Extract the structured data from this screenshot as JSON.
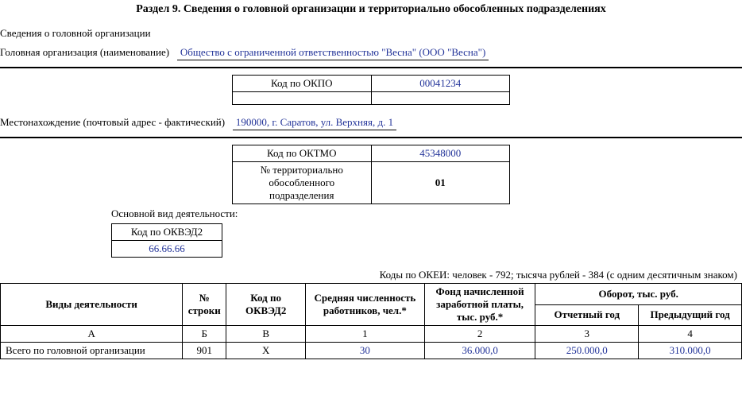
{
  "section_title": "Раздел 9. Сведения о головной организации и территориально обособленных подразделениях",
  "head_org_info_label": "Сведения о головной организации",
  "head_org_name_label": "Головная организация (наименование)",
  "head_org_name_value": "Общество с ограниченной ответственностью \"Весна\" (ООО \"Весна\")",
  "okpo": {
    "label": "Код по ОКПО",
    "value": "00041234"
  },
  "location_label": "Местонахождение (почтовый адрес - фактический)",
  "location_value": "190000, г. Саратов, ул. Верхняя, д. 1",
  "oktmo": {
    "label": "Код по ОКТМО",
    "value": "45348000"
  },
  "unit": {
    "label": "№ территориально обособленного подразделения",
    "value": "01"
  },
  "activity_label": "Основной вид деятельности:",
  "okved": {
    "label": "Код по ОКВЭД2",
    "value": "66.66.66"
  },
  "okei_note": "Коды по ОКЕИ: человек - 792; тысяча рублей - 384 (с одним десятичным знаком)",
  "table": {
    "headers": {
      "a": "Виды деятельности",
      "b": "№ строки",
      "v": "Код по ОКВЭД2",
      "c1": "Средняя численность работников, чел.*",
      "c2": "Фонд начисленной заработной платы, тыс. руб.*",
      "turnover": "Оборот, тыс. руб.",
      "c3": "Отчетный год",
      "c4": "Предыдущий год"
    },
    "col_letters": {
      "a": "А",
      "b": "Б",
      "v": "В",
      "c1": "1",
      "c2": "2",
      "c3": "3",
      "c4": "4"
    },
    "rows": [
      {
        "a": "Всего по головной организации",
        "b": "901",
        "v": "Х",
        "c1": "30",
        "c2": "36.000,0",
        "c3": "250.000,0",
        "c4": "310.000,0"
      }
    ]
  }
}
